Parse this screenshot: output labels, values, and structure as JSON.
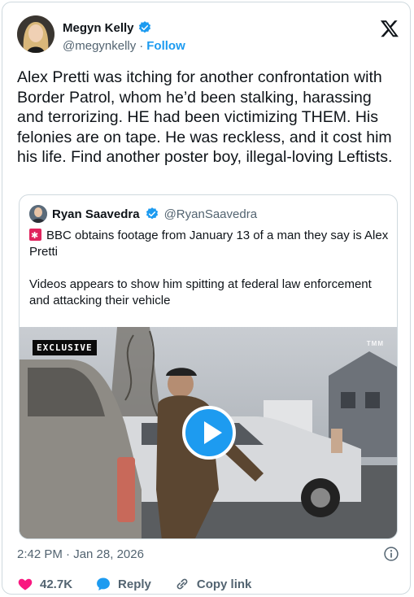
{
  "author": {
    "name": "Megyn Kelly",
    "handle": "@megynkelly",
    "separator": "·",
    "follow_label": "Follow"
  },
  "tweet_text": "Alex Pretti was itching for another confrontation with Border Patrol, whom he’d been stalking, harassing and terrorizing. HE had been victimizing THEM. His felonies are on tape. He was reckless, and it cost him his life. Find another poster boy, illegal-loving Leftists.",
  "quoted": {
    "name": "Ryan Saavedra",
    "handle": "@RyanSaavedra",
    "line1": "BBC obtains footage from January 13 of a man they say is Alex Pretti",
    "line2": "Videos appears to show him spitting at federal law enforcement and attacking their vehicle",
    "video": {
      "badge": "EXCLUSIVE",
      "watermark": "TMM"
    }
  },
  "timestamp": "2:42 PM · Jan 28, 2026",
  "actions": {
    "likes": "42.7K",
    "reply_label": "Reply",
    "copy_label": "Copy link"
  },
  "colors": {
    "accent": "#1d9bf0",
    "like": "#f91880",
    "muted": "#536471"
  }
}
